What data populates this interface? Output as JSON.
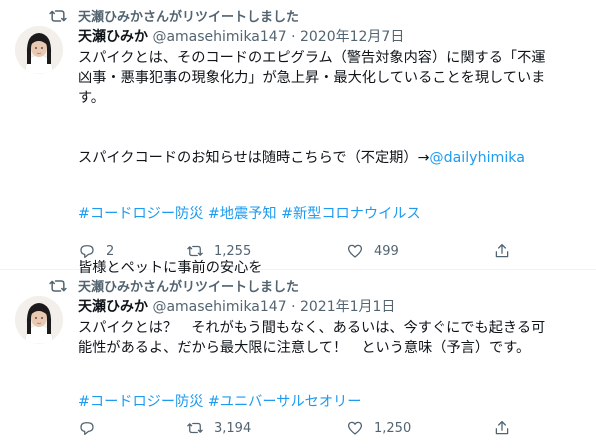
{
  "tweets": [
    {
      "retweet_label": "天瀬ひみかさんがリツイートしました",
      "name": "天瀬ひみか",
      "handle": "@amasehimika147",
      "separator": "·",
      "date": "2020年12月7日",
      "lines": [
        "スパイクとは、そのコードのエピグラム（警告対象内容）に関する「不運",
        "凶事・悪事犯事の現象化力」が急上昇・最大化していることを現していま",
        "す。"
      ],
      "notice_text": "スパイクコードのお知らせは随時こちらで（不定期）→",
      "notice_link": "@dailyhimika",
      "hashtags": [
        "#コードロジー防災",
        "#地震予知",
        "#新型コロナウイルス"
      ],
      "closing": "皆様とペットに事前の安心を",
      "replies": "2",
      "retweets": "1,255",
      "likes": "499"
    },
    {
      "retweet_label": "天瀬ひみかさんがリツイートしました",
      "name": "天瀬ひみか",
      "handle": "@amasehimika147",
      "separator": "·",
      "date": "2021年1月1日",
      "lines": [
        "スパイクとは？　それがもう間もなく、あるいは、今すぐにでも起きる可",
        "能性があるよ、だから最大限に注意して！　という意味（予言）です。"
      ],
      "hashtags": [
        "#コードロジー防災",
        "#ユニバーサルセオリー"
      ],
      "replies": "",
      "retweets": "3,194",
      "likes": "1,250"
    }
  ],
  "colors": {
    "text": "#0f1419",
    "secondary": "#536471",
    "link": "#1d9bf0",
    "divider": "#eff3f4"
  },
  "icons": [
    "retweet-icon",
    "reply-icon",
    "like-icon",
    "share-icon"
  ]
}
